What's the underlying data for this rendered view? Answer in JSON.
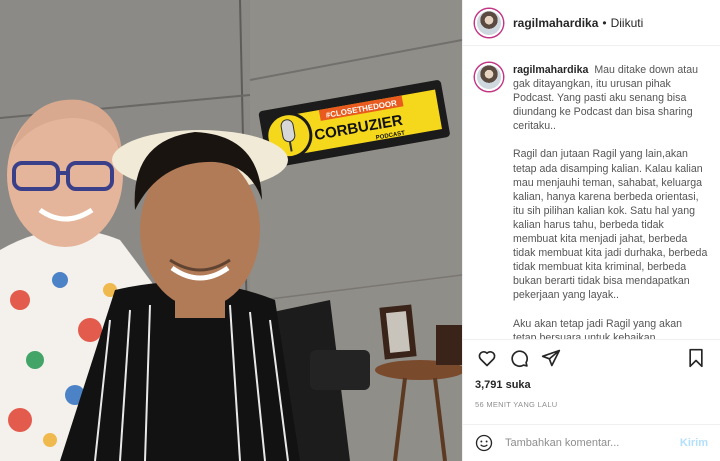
{
  "post": {
    "username": "ragilmahardika",
    "follow_status": "Diikuti",
    "separator": "•",
    "caption_paragraphs": [
      "Mau ditake down atau gak ditayangkan, itu urusan pihak Podcast. Yang pasti aku senang bisa diundang ke Podcast dan bisa sharing ceritaku..",
      "Ragil dan jutaan Ragil yang lain,akan tetap ada disamping kalian. Kalau kalian mau menjauhi teman, sahabat, keluarga kalian, hanya karena berbeda orientasi, itu sih pilihan kalian kok. Satu hal yang kalian harus tahu, berbeda tidak membuat kita menjadi jahat, berbeda tidak membuat kita jadi durhaka, berbeda tidak membuat kita kriminal, berbeda bukan berarti tidak bisa mendapatkan pekerjaan yang layak..",
      "Aku akan tetap jadi Ragil yang akan tetap bersuara untuk kebaikan"
    ],
    "likes": "3,791 suka",
    "time_ago": "56 MENIT YANG LALU"
  },
  "photo": {
    "sign_hashtag": "#CLOSETHEDOOR",
    "sign_brand": "CORBUZIER",
    "sign_sub": "PODCAST"
  },
  "comment": {
    "placeholder": "Tambahkan komentar...",
    "post_label": "Kirim"
  },
  "icons": {
    "like": "heart-icon",
    "comment": "comment-bubble-icon",
    "share": "paper-plane-icon",
    "save": "bookmark-icon",
    "emoji": "smiley-icon"
  },
  "colors": {
    "sign_yellow": "#f5d71b",
    "link_disabled": "#b2dffc",
    "story_ring": "#c13584"
  }
}
